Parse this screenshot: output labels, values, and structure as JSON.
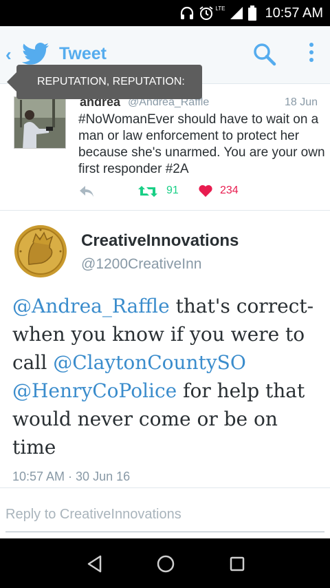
{
  "status_bar": {
    "network": "LTE",
    "time": "10:57 AM"
  },
  "toolbar": {
    "title": "Tweet",
    "icons": [
      "back-chevron-icon",
      "twitter-bird-icon",
      "search-icon",
      "more-vertical-icon"
    ],
    "accent_color": "#55acee"
  },
  "tooltip": {
    "text": "REPUTATION, REPUTATION:"
  },
  "parent_tweet": {
    "name": "andrea",
    "handle": "@Andrea_Raffle",
    "date": "18 Jun",
    "text": "#NoWomanEver should have to wait on a man or law enforcement to protect her because she's unarmed. You are your own first responder #2A",
    "retweets": "91",
    "likes": "234",
    "retweet_color": "#19cf86",
    "like_color": "#e81c4f"
  },
  "main_tweet": {
    "name": "CreativeInnovations",
    "handle": "@1200CreativeInn",
    "text_parts": {
      "mention1": "@Andrea_Raffle",
      "text1": " that's correct- when you know if you were to call ",
      "mention2": "@ClaytonCountySO",
      "text2": " ",
      "mention3": "@HenryCoPolice",
      "text3": " for help that would never come or be on time"
    },
    "timestamp": "10:57 AM · 30 Jun 16",
    "mention_color": "#3a8ccc"
  },
  "reply": {
    "placeholder": "Reply to CreativeInnovations"
  },
  "nav_bar": {
    "icons": [
      "nav-back-icon",
      "nav-home-icon",
      "nav-recents-icon"
    ]
  }
}
